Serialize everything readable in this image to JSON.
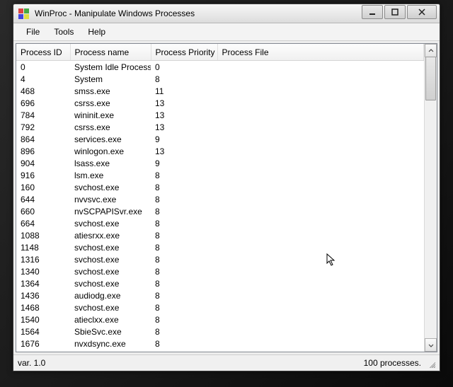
{
  "window": {
    "title": "WinProc - Manipulate Windows Processes"
  },
  "menu": {
    "file": "File",
    "tools": "Tools",
    "help": "Help"
  },
  "columns": {
    "id": "Process ID",
    "name": "Process name",
    "priority": "Process Priority",
    "file": "Process File"
  },
  "rows": [
    {
      "id": "0",
      "name": "System Idle Process",
      "pri": "0",
      "file": ""
    },
    {
      "id": "4",
      "name": "System",
      "pri": "8",
      "file": ""
    },
    {
      "id": "468",
      "name": "smss.exe",
      "pri": "11",
      "file": ""
    },
    {
      "id": "696",
      "name": "csrss.exe",
      "pri": "13",
      "file": ""
    },
    {
      "id": "784",
      "name": "wininit.exe",
      "pri": "13",
      "file": ""
    },
    {
      "id": "792",
      "name": "csrss.exe",
      "pri": "13",
      "file": ""
    },
    {
      "id": "864",
      "name": "services.exe",
      "pri": "9",
      "file": ""
    },
    {
      "id": "896",
      "name": "winlogon.exe",
      "pri": "13",
      "file": ""
    },
    {
      "id": "904",
      "name": "lsass.exe",
      "pri": "9",
      "file": ""
    },
    {
      "id": "916",
      "name": "lsm.exe",
      "pri": "8",
      "file": ""
    },
    {
      "id": "160",
      "name": "svchost.exe",
      "pri": "8",
      "file": ""
    },
    {
      "id": "644",
      "name": "nvvsvc.exe",
      "pri": "8",
      "file": ""
    },
    {
      "id": "660",
      "name": "nvSCPAPISvr.exe",
      "pri": "8",
      "file": ""
    },
    {
      "id": "664",
      "name": "svchost.exe",
      "pri": "8",
      "file": ""
    },
    {
      "id": "1088",
      "name": "atiesrxx.exe",
      "pri": "8",
      "file": ""
    },
    {
      "id": "1148",
      "name": "svchost.exe",
      "pri": "8",
      "file": ""
    },
    {
      "id": "1316",
      "name": "svchost.exe",
      "pri": "8",
      "file": ""
    },
    {
      "id": "1340",
      "name": "svchost.exe",
      "pri": "8",
      "file": ""
    },
    {
      "id": "1364",
      "name": "svchost.exe",
      "pri": "8",
      "file": ""
    },
    {
      "id": "1436",
      "name": "audiodg.exe",
      "pri": "8",
      "file": ""
    },
    {
      "id": "1468",
      "name": "svchost.exe",
      "pri": "8",
      "file": ""
    },
    {
      "id": "1540",
      "name": "atieclxx.exe",
      "pri": "8",
      "file": ""
    },
    {
      "id": "1564",
      "name": "SbieSvc.exe",
      "pri": "8",
      "file": ""
    },
    {
      "id": "1676",
      "name": "nvxdsync.exe",
      "pri": "8",
      "file": ""
    }
  ],
  "status": {
    "left": "var. 1.0",
    "right": "100 processes."
  }
}
